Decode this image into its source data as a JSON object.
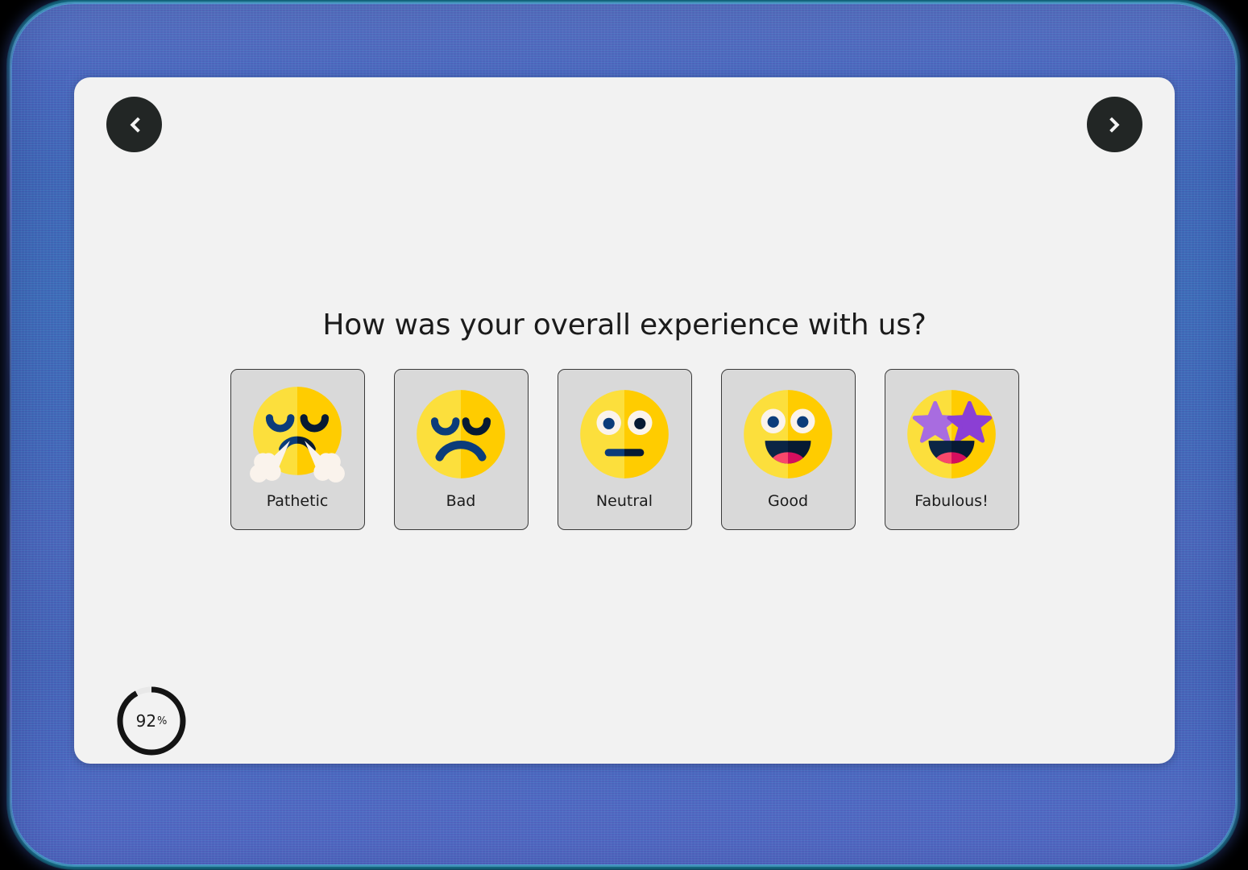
{
  "survey": {
    "question": "How was your overall experience with us?",
    "options": [
      {
        "label": "Pathetic",
        "emoji_name": "face-with-steam-from-nose-emoji"
      },
      {
        "label": "Bad",
        "emoji_name": "disappointed-face-emoji"
      },
      {
        "label": "Neutral",
        "emoji_name": "neutral-face-emoji"
      },
      {
        "label": "Good",
        "emoji_name": "grinning-face-emoji"
      },
      {
        "label": "Fabulous!",
        "emoji_name": "star-struck-face-emoji"
      }
    ]
  },
  "navigation": {
    "prev_icon": "chevron-left-icon",
    "next_icon": "chevron-right-icon"
  },
  "progress": {
    "value": "92",
    "unit": "%",
    "percent": 92
  },
  "colors": {
    "frame": "#4463b8",
    "card_bg": "#F2F2F2",
    "option_bg": "#D9D9D9",
    "option_border": "#3a3a3a",
    "nav_button": "#222625",
    "face_light": "#FCDF3C",
    "face_dark": "#FFCC00",
    "face_ink": "#0B2545",
    "face_ink_dark": "#071A33",
    "eye_white": "#FAF3EC",
    "tongue_light": "#F9486B",
    "tongue_dark": "#D40E5E",
    "star_light": "#A86CE0",
    "star_dark": "#8B3FD4",
    "steam": "#FAF3EC",
    "progress_track": "#E3E3E3",
    "progress_fill": "#141414",
    "text": "#1b1b1b"
  }
}
